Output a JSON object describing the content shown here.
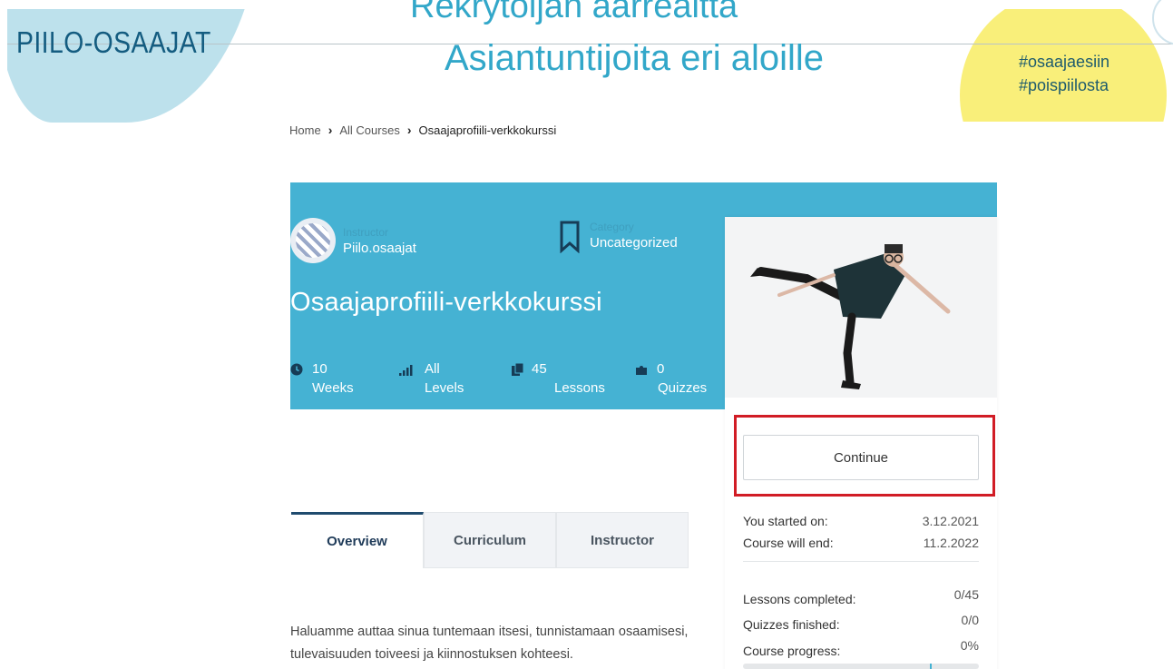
{
  "header": {
    "logo": "PIILO-OSAAJAT",
    "headline_top": "Rekrytoijan aarreaitta",
    "headline_bottom": "Asiantuntijoita eri aloille",
    "hashtag_1": "#osaajaesiin",
    "hashtag_2": "#poispiilosta",
    "colors": {
      "accent": "#32a7c9",
      "logo": "#145c80",
      "yellow": "#f9ef7a",
      "light_blue": "#bde1ec"
    }
  },
  "breadcrumb": {
    "home": "Home",
    "all_courses": "All Courses",
    "current": "Osaajaprofiili-verkkokurssi"
  },
  "course": {
    "instructor_label": "Instructor",
    "instructor_name": "Piilo.osaajat",
    "category_label": "Category",
    "category_name": "Uncategorized",
    "title": "Osaajaprofiili-verkkokurssi",
    "stats": {
      "duration_value": "10",
      "duration_unit": "Weeks",
      "level_value": "All",
      "level_unit": "Levels",
      "lessons_value": "45",
      "lessons_unit": "Lessons",
      "quizzes_value": "0",
      "quizzes_unit": "Quizzes"
    },
    "colors": {
      "hero": "#45b2d3"
    }
  },
  "sidebar": {
    "continue_label": "Continue",
    "started_label": "You started on:",
    "started_value": "3.12.2021",
    "end_label": "Course will end:",
    "end_value": "11.2.2022",
    "lessons_label": "Lessons completed:",
    "lessons_value": "0/45",
    "quizzes_label": "Quizzes finished:",
    "quizzes_value": "0/0",
    "progress_label": "Course progress:",
    "progress_value": "0%",
    "progress_fraction": 0,
    "highlight_color": "#d11c25"
  },
  "tabs": {
    "overview": "Overview",
    "curriculum": "Curriculum",
    "instructor": "Instructor"
  },
  "description": "Haluamme auttaa sinua tuntemaan itsesi, tunnistamaan osaamisesi, tulevaisuuden toiveesi ja kiinnostuksen kohteesi."
}
